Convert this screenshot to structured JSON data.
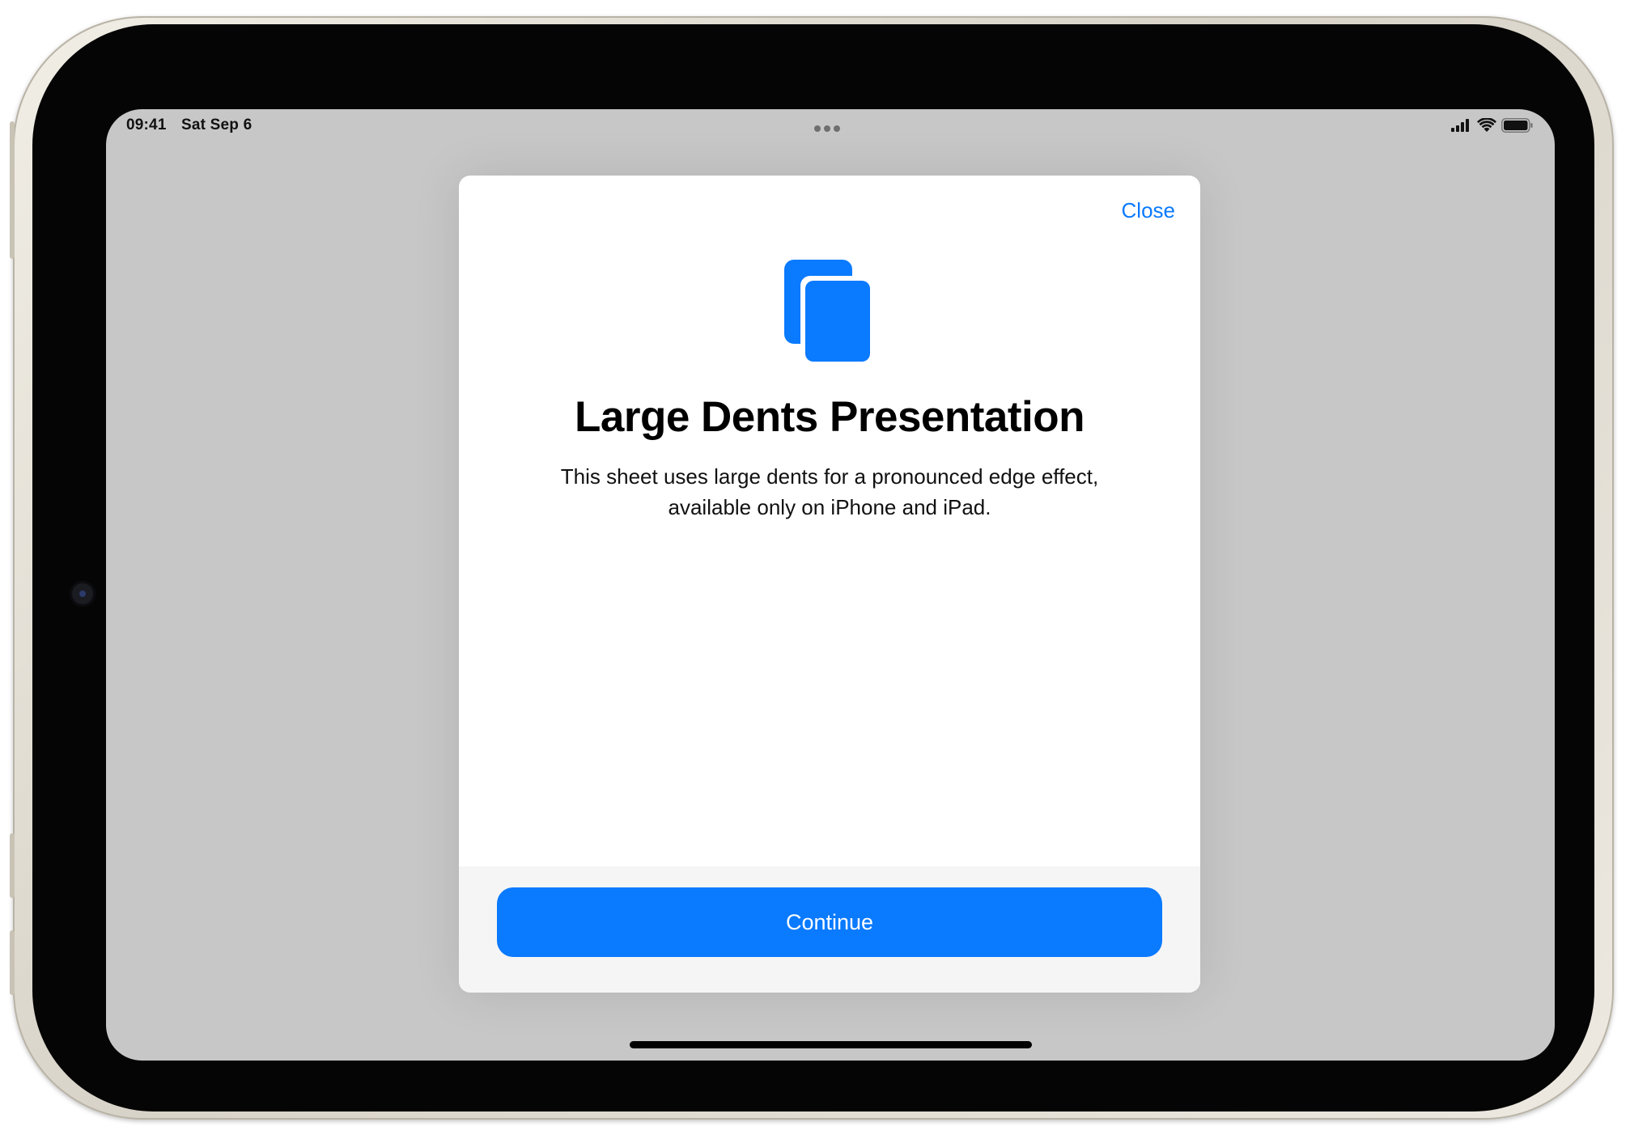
{
  "status_bar": {
    "time": "09:41",
    "date": "Sat Sep 6",
    "icons": [
      "cellular-signal-icon",
      "wifi-icon",
      "battery-icon"
    ]
  },
  "multitasking": {
    "icon": "multitasking-dots-icon"
  },
  "sheet": {
    "close_label": "Close",
    "icon": "stacked-pages-icon",
    "title": "Large Dents Presentation",
    "body": "This sheet uses large dents for a pronounced edge effect, available only on iPhone and iPad.",
    "continue_label": "Continue"
  },
  "colors": {
    "accent": "#0a7aff",
    "dimmed_background": "#c6c7c6",
    "sheet_background": "#ffffff",
    "footer_background": "#f5f5f5"
  }
}
